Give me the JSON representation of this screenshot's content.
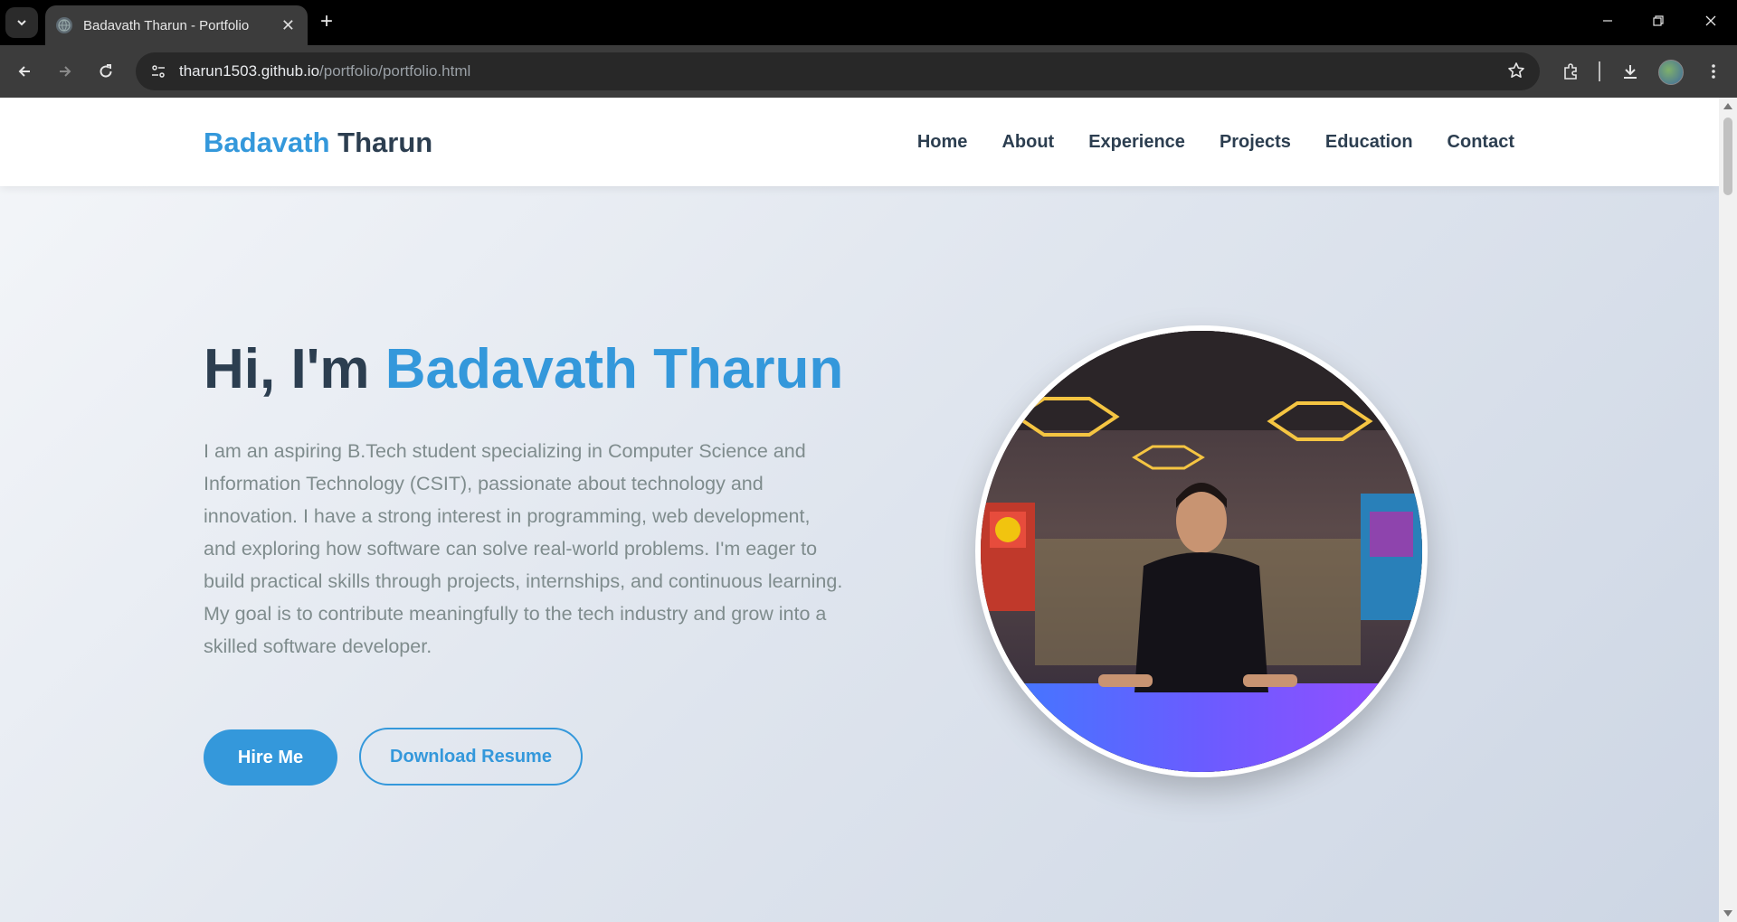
{
  "browser": {
    "tab_title": "Badavath Tharun - Portfolio",
    "url_host": "tharun1503.github.io",
    "url_path": "/portfolio/portfolio.html"
  },
  "site": {
    "logo_first": "Badavath",
    "logo_last": "Tharun",
    "nav": [
      "Home",
      "About",
      "Experience",
      "Projects",
      "Education",
      "Contact"
    ]
  },
  "hero": {
    "greeting": "Hi, I'm ",
    "name": "Badavath Tharun",
    "description": "I am an aspiring B.Tech student specializing in Computer Science and Information Technology (CSIT), passionate about technology and innovation. I have a strong interest in programming, web development, and exploring how software can solve real-world problems. I'm eager to build practical skills through projects, internships, and continuous learning. My goal is to contribute meaningfully to the tech industry and grow into a skilled software developer.",
    "primary_button": "Hire Me",
    "secondary_button": "Download Resume"
  },
  "colors": {
    "accent": "#3498db",
    "heading": "#2c3e50",
    "body_text": "#7f8c8d"
  }
}
